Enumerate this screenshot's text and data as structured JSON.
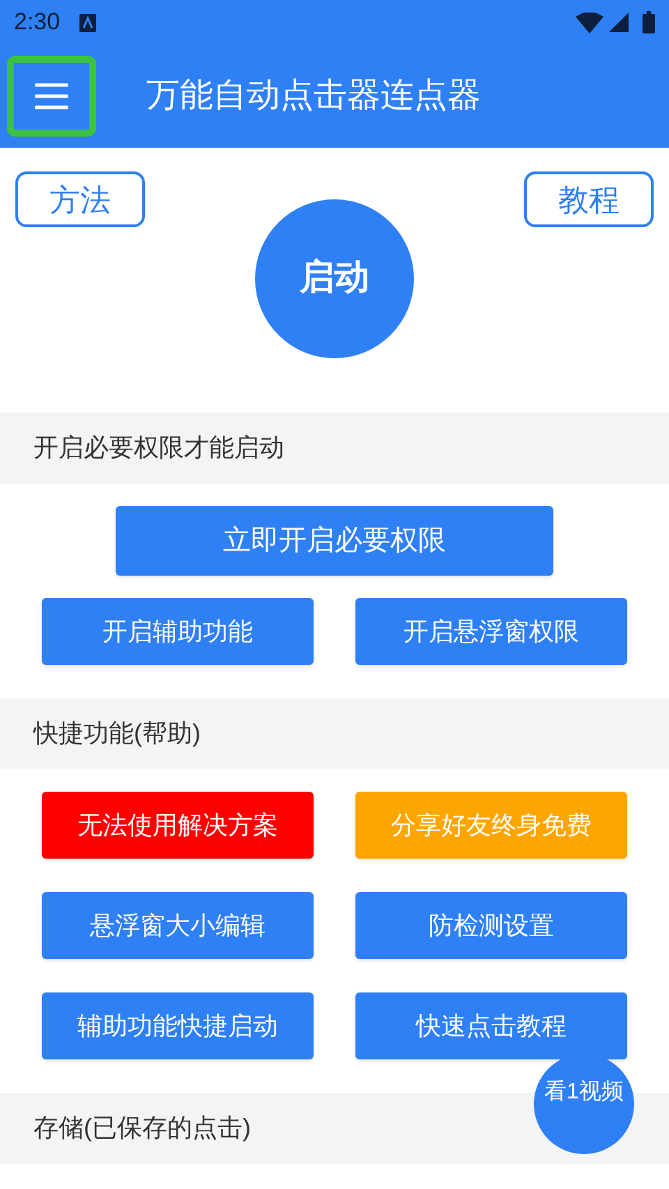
{
  "status_bar": {
    "time": "2:30"
  },
  "toolbar": {
    "title": "万能自动点击器连点器"
  },
  "top_buttons": [
    "方法",
    "教程"
  ],
  "start_button": "启动",
  "sections": [
    {
      "title": "开启必要权限才能启动",
      "buttons": [
        {
          "label": "立即开启必要权限",
          "color": "#2f80f5",
          "wide": true
        },
        {
          "label": "开启辅助功能",
          "color": "#2f80f5",
          "wide": false
        },
        {
          "label": "开启悬浮窗权限",
          "color": "#2f80f5",
          "wide": false
        }
      ]
    },
    {
      "title": "快捷功能(帮助)",
      "buttons": [
        {
          "label": "无法使用解决方案",
          "color": "#ff0000",
          "wide": false
        },
        {
          "label": "分享好友终身免费",
          "color": "#ffa500",
          "wide": false
        },
        {
          "label": "悬浮窗大小编辑",
          "color": "#2f80f5",
          "wide": false
        },
        {
          "label": "防检测设置",
          "color": "#2f80f5",
          "wide": false
        },
        {
          "label": "辅助功能快捷启动",
          "color": "#2f80f5",
          "wide": false
        },
        {
          "label": "快速点击教程",
          "color": "#2f80f5",
          "wide": false
        }
      ]
    },
    {
      "title": "存储(已保存的点击)"
    }
  ],
  "float_badge": "看1视频"
}
